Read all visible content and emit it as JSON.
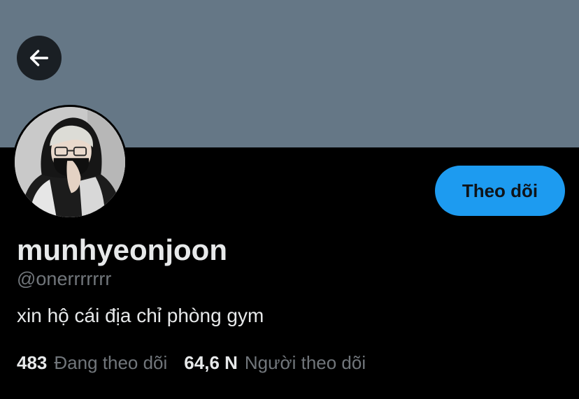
{
  "header": {
    "back_icon": "arrow-left-icon"
  },
  "profile": {
    "display_name": "munhyeonjoon",
    "handle": "@onerrrrrrr",
    "bio": "xin hộ cái địa chỉ phòng gym",
    "follow_label": "Theo dõi",
    "following_count": "483",
    "following_label": "Đang theo dõi",
    "followers_count": "64,6 N",
    "followers_label": "Người theo dõi"
  },
  "colors": {
    "banner": "#657786",
    "background": "#000000",
    "follow_button": "#1d9bf0",
    "text_primary": "#e7e9ea",
    "text_secondary": "#71767b"
  }
}
